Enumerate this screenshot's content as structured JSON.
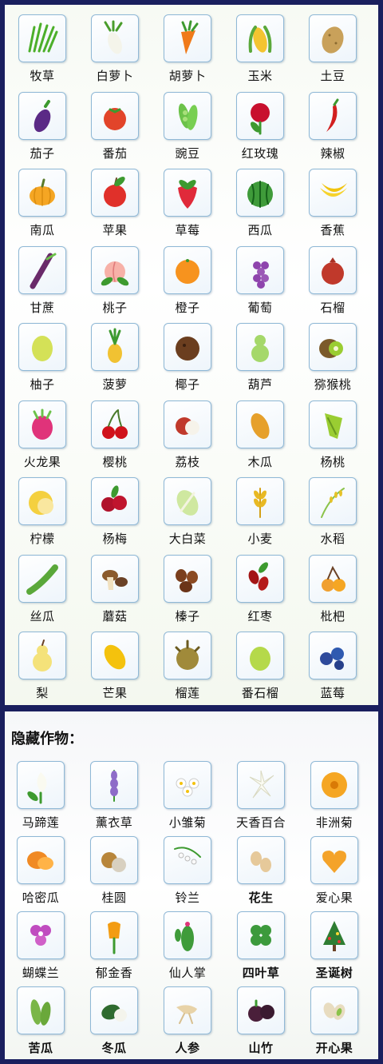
{
  "colors": {
    "frame": "#1a1f5e",
    "tile_border": "#8fb8d6"
  },
  "crops": [
    {
      "label": "牧草",
      "icon": "grass-icon"
    },
    {
      "label": "白萝卜",
      "icon": "white-radish-icon"
    },
    {
      "label": "胡萝卜",
      "icon": "carrot-icon"
    },
    {
      "label": "玉米",
      "icon": "corn-icon"
    },
    {
      "label": "土豆",
      "icon": "potato-icon"
    },
    {
      "label": "茄子",
      "icon": "eggplant-icon"
    },
    {
      "label": "番茄",
      "icon": "tomato-icon"
    },
    {
      "label": "豌豆",
      "icon": "pea-icon"
    },
    {
      "label": "红玫瑰",
      "icon": "red-rose-icon"
    },
    {
      "label": "辣椒",
      "icon": "chili-icon"
    },
    {
      "label": "南瓜",
      "icon": "pumpkin-icon"
    },
    {
      "label": "苹果",
      "icon": "apple-icon"
    },
    {
      "label": "草莓",
      "icon": "strawberry-icon"
    },
    {
      "label": "西瓜",
      "icon": "watermelon-icon"
    },
    {
      "label": "香蕉",
      "icon": "banana-icon"
    },
    {
      "label": "甘蔗",
      "icon": "sugarcane-icon"
    },
    {
      "label": "桃子",
      "icon": "peach-icon"
    },
    {
      "label": "橙子",
      "icon": "orange-icon"
    },
    {
      "label": "葡萄",
      "icon": "grape-icon"
    },
    {
      "label": "石榴",
      "icon": "pomegranate-icon"
    },
    {
      "label": "柚子",
      "icon": "pomelo-icon"
    },
    {
      "label": "菠萝",
      "icon": "pineapple-icon"
    },
    {
      "label": "椰子",
      "icon": "coconut-icon"
    },
    {
      "label": "葫芦",
      "icon": "gourd-icon"
    },
    {
      "label": "猕猴桃",
      "icon": "kiwi-icon"
    },
    {
      "label": "火龙果",
      "icon": "dragon-fruit-icon"
    },
    {
      "label": "樱桃",
      "icon": "cherry-icon"
    },
    {
      "label": "荔枝",
      "icon": "lychee-icon"
    },
    {
      "label": "木瓜",
      "icon": "papaya-icon"
    },
    {
      "label": "杨桃",
      "icon": "starfruit-icon"
    },
    {
      "label": "柠檬",
      "icon": "lemon-icon"
    },
    {
      "label": "杨梅",
      "icon": "bayberry-icon"
    },
    {
      "label": "大白菜",
      "icon": "napa-cabbage-icon"
    },
    {
      "label": "小麦",
      "icon": "wheat-icon"
    },
    {
      "label": "水稻",
      "icon": "rice-icon"
    },
    {
      "label": "丝瓜",
      "icon": "loofah-icon"
    },
    {
      "label": "蘑菇",
      "icon": "mushroom-icon"
    },
    {
      "label": "榛子",
      "icon": "hazelnut-icon"
    },
    {
      "label": "红枣",
      "icon": "jujube-icon"
    },
    {
      "label": "枇杷",
      "icon": "loquat-icon"
    },
    {
      "label": "梨",
      "icon": "pear-icon"
    },
    {
      "label": "芒果",
      "icon": "mango-icon"
    },
    {
      "label": "榴莲",
      "icon": "durian-icon"
    },
    {
      "label": "番石榴",
      "icon": "guava-icon"
    },
    {
      "label": "蓝莓",
      "icon": "blueberry-icon"
    }
  ],
  "hidden_section": {
    "title": "隐藏作物：",
    "crops": [
      {
        "label": "马蹄莲",
        "icon": "calla-lily-icon"
      },
      {
        "label": "薰衣草",
        "icon": "lavender-icon"
      },
      {
        "label": "小雏菊",
        "icon": "daisy-icon"
      },
      {
        "label": "天香百合",
        "icon": "lily-icon"
      },
      {
        "label": "非洲菊",
        "icon": "gerbera-icon"
      },
      {
        "label": "哈密瓜",
        "icon": "hami-melon-icon"
      },
      {
        "label": "桂圆",
        "icon": "longan-icon"
      },
      {
        "label": "铃兰",
        "icon": "lily-of-the-valley-icon"
      },
      {
        "label": "花生",
        "icon": "peanut-icon"
      },
      {
        "label": "爱心果",
        "icon": "heart-fruit-icon"
      },
      {
        "label": "蝴蝶兰",
        "icon": "orchid-icon"
      },
      {
        "label": "郁金香",
        "icon": "tulip-icon"
      },
      {
        "label": "仙人掌",
        "icon": "cactus-icon"
      },
      {
        "label": "四叶草",
        "icon": "clover-icon"
      },
      {
        "label": "圣诞树",
        "icon": "christmas-tree-icon"
      },
      {
        "label": "苦瓜",
        "icon": "bitter-melon-icon"
      },
      {
        "label": "冬瓜",
        "icon": "winter-melon-icon"
      },
      {
        "label": "人参",
        "icon": "ginseng-icon"
      },
      {
        "label": "山竹",
        "icon": "mangosteen-icon"
      },
      {
        "label": "开心果",
        "icon": "pistachio-icon"
      }
    ]
  }
}
